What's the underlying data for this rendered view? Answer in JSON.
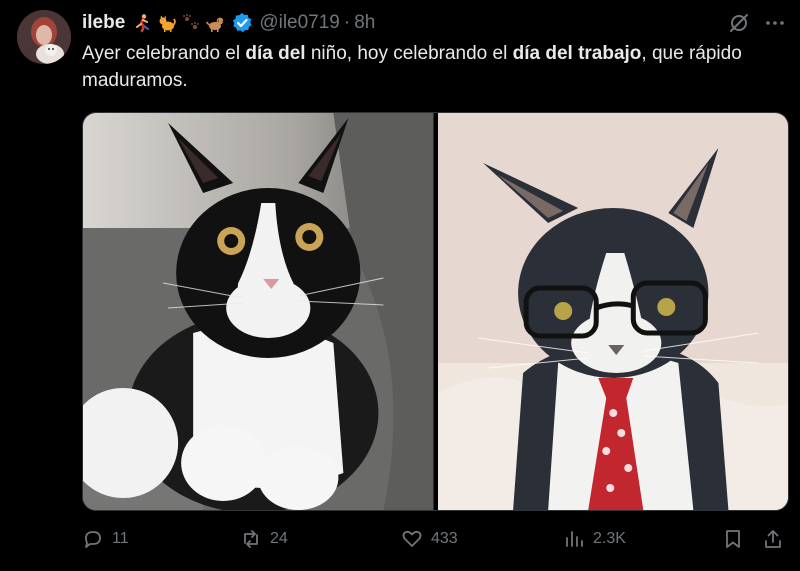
{
  "tweet": {
    "author_name": "ilebe",
    "emojis": [
      "runner-emoji",
      "cat-emoji",
      "paw-prints-emoji",
      "dog-emoji"
    ],
    "handle": "@ile0719",
    "dot": "·",
    "time": "8h",
    "text_parts": [
      {
        "text": "Ayer celebrando el ",
        "bold": false
      },
      {
        "text": "día del",
        "bold": true
      },
      {
        "text": " niño, hoy celebrando el ",
        "bold": false
      },
      {
        "text": "día del trabajo",
        "bold": true
      },
      {
        "text": ", que rápido maduramos.",
        "bold": false
      }
    ]
  },
  "actions": {
    "replies": "11",
    "reposts": "24",
    "likes": "433",
    "views": "2.3K"
  },
  "colors": {
    "background": "#000000",
    "text": "#e7e9ea",
    "muted": "#71767b",
    "verified": "#1d9bf0"
  }
}
